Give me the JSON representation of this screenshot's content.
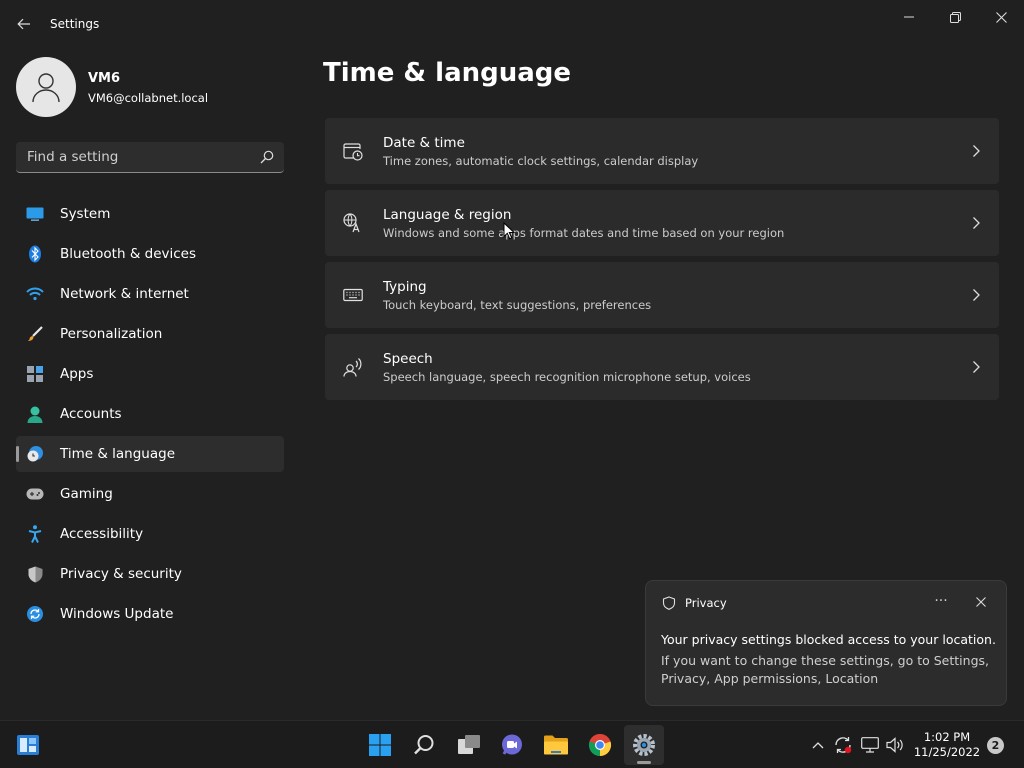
{
  "window": {
    "title": "Settings"
  },
  "user": {
    "name": "VM6",
    "email": "VM6@collabnet.local"
  },
  "search": {
    "placeholder": "Find a setting"
  },
  "nav": {
    "selected": "Time & language",
    "items": [
      {
        "label": "System",
        "icon": "monitor-icon"
      },
      {
        "label": "Bluetooth & devices",
        "icon": "bluetooth-icon"
      },
      {
        "label": "Network & internet",
        "icon": "wifi-icon"
      },
      {
        "label": "Personalization",
        "icon": "brush-icon"
      },
      {
        "label": "Apps",
        "icon": "apps-icon"
      },
      {
        "label": "Accounts",
        "icon": "person-icon"
      },
      {
        "label": "Time & language",
        "icon": "clock-globe-icon"
      },
      {
        "label": "Gaming",
        "icon": "gamepad-icon"
      },
      {
        "label": "Accessibility",
        "icon": "accessibility-icon"
      },
      {
        "label": "Privacy & security",
        "icon": "shield-icon"
      },
      {
        "label": "Windows Update",
        "icon": "update-icon"
      }
    ]
  },
  "page": {
    "title": "Time & language",
    "cards": [
      {
        "title": "Date & time",
        "subtitle": "Time zones, automatic clock settings, calendar display",
        "icon": "calendar-clock-icon"
      },
      {
        "title": "Language & region",
        "subtitle": "Windows and some apps format dates and time based on your region",
        "icon": "language-icon"
      },
      {
        "title": "Typing",
        "subtitle": "Touch keyboard, text suggestions, preferences",
        "icon": "keyboard-icon"
      },
      {
        "title": "Speech",
        "subtitle": "Speech language, speech recognition microphone setup, voices",
        "icon": "speech-icon"
      }
    ]
  },
  "toast": {
    "app": "Privacy",
    "more": "···",
    "title": "Your privacy settings blocked access to your location.",
    "body": "If you want to change these settings, go to Settings, Privacy, App permissions, Location"
  },
  "taskbar": {
    "time": "1:02 PM",
    "date": "11/25/2022",
    "notifications": "2"
  },
  "colors": {
    "background": "#202020",
    "card": "#2b2b2b",
    "taskbar": "#1c1c1c",
    "accent": "#0078d4"
  }
}
